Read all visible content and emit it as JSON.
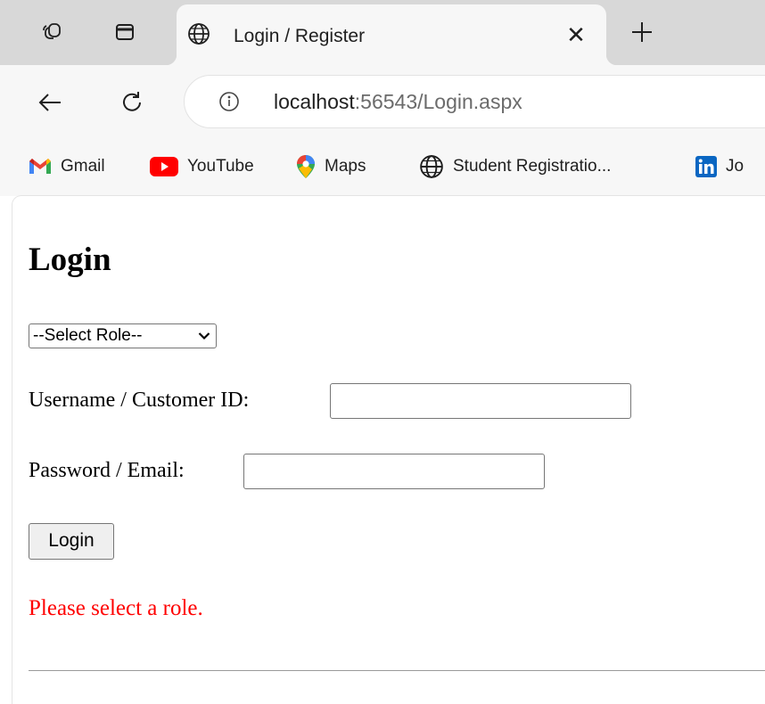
{
  "browser": {
    "tab": {
      "title": "Login / Register",
      "close_glyph": "✕"
    },
    "new_tab_icon": "plus-icon",
    "address": {
      "host": "localhost",
      "rest": ":56543/Login.aspx"
    },
    "bookmarks": [
      {
        "label": "Gmail",
        "icon": "gmail-icon"
      },
      {
        "label": "YouTube",
        "icon": "youtube-icon"
      },
      {
        "label": "Maps",
        "icon": "maps-icon"
      },
      {
        "label": "Student Registratio...",
        "icon": "globe-icon"
      },
      {
        "label": "Jo",
        "icon": "linkedin-icon"
      }
    ]
  },
  "page": {
    "heading": "Login",
    "role_select": {
      "selected": "--Select Role--"
    },
    "username_label": "Username / Customer ID:",
    "password_label": "Password / Email:",
    "login_button": "Login",
    "error_message": "Please select a role.",
    "error_color": "#ff0000"
  }
}
